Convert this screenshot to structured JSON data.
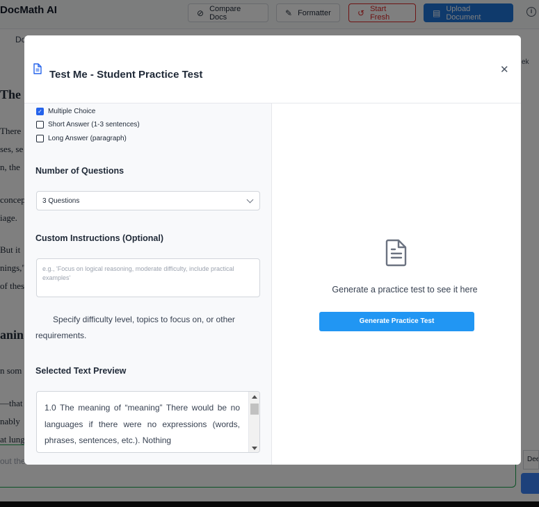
{
  "app": {
    "logo": "DocMath AI",
    "buttons": {
      "compare": "Compare Docs",
      "formatter": "Formatter",
      "start_fresh": "Start Fresh",
      "upload": "Upload Document"
    },
    "doc_tab": "Do",
    "right_pane_label": "ek",
    "bottom_input_partial": "out the",
    "right_chip_partial": "Dee"
  },
  "background_doc": {
    "lines": [
      "The",
      "There",
      "ses, se",
      "n, the",
      "concep",
      "iage.",
      "But it",
      "nings,\"",
      "of thes",
      "anin",
      "n som",
      "—that",
      "nably",
      "at lung"
    ]
  },
  "modal": {
    "title": "Test Me - Student Practice Test",
    "question_types": [
      {
        "label": "Multiple Choice",
        "checked": true
      },
      {
        "label": "Short Answer (1-3 sentences)",
        "checked": false
      },
      {
        "label": "Long Answer (paragraph)",
        "checked": false
      }
    ],
    "num_questions_label": "Number of Questions",
    "num_questions_value": "3 Questions",
    "custom_instructions_label": "Custom Instructions (Optional)",
    "custom_instructions_placeholder": "e.g., 'Focus on logical reasoning, moderate difficulty, include practical examples'",
    "custom_instructions_help": "Specify difficulty level, topics to focus on, or other requirements.",
    "preview_label": "Selected Text Preview",
    "preview_text": "1.0 The meaning of “meaning” There would be no languages if there were no expressions (words, phrases, sentences, etc.). Nothing",
    "empty_state_text": "Generate a practice test to see it here",
    "generate_button": "Generate Practice Test"
  },
  "colors": {
    "primary": "#1e74d8",
    "danger": "#dc2626",
    "generate": "#2196f3",
    "checkbox": "#2563eb"
  }
}
